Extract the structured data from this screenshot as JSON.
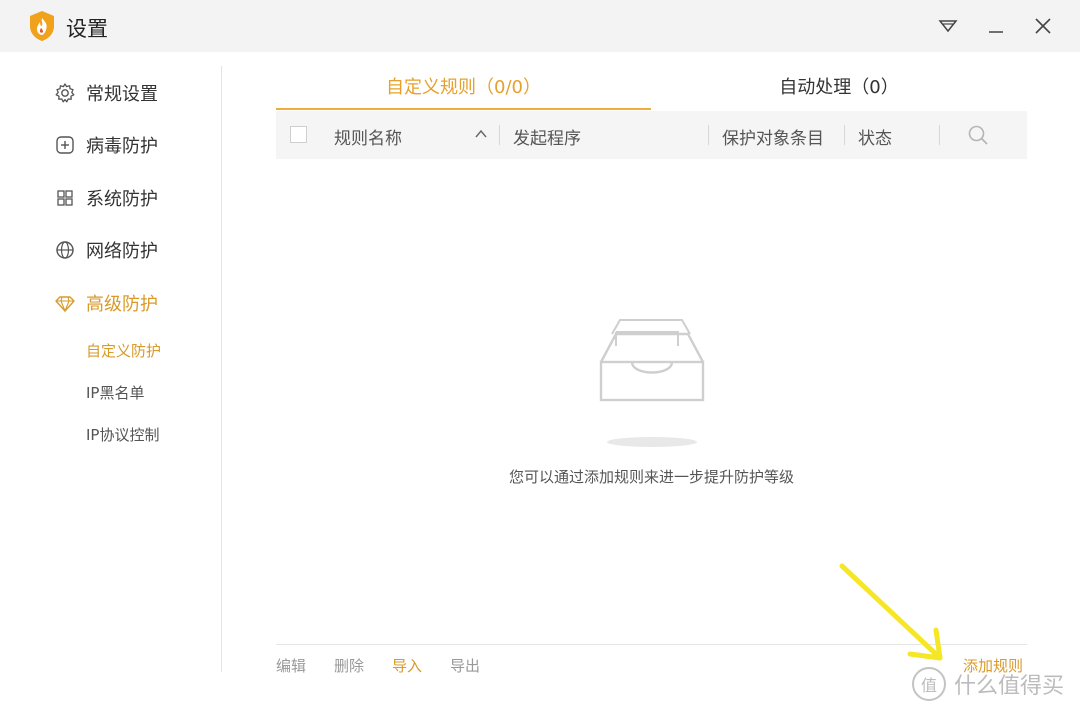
{
  "window": {
    "title": "设置",
    "icons": {
      "logo": "shield-flame-logo",
      "menu": "dropdown-menu-icon",
      "minimize": "minimize-icon",
      "close": "close-icon"
    }
  },
  "colors": {
    "accent": "#e6a12c",
    "nav_active": "#d99a29",
    "titlebar_bg": "#f3f3f3",
    "header_bg": "#f5f5f5",
    "arrow": "#f5e626"
  },
  "sidebar": {
    "items": [
      {
        "label": "常规设置",
        "icon": "gear-icon"
      },
      {
        "label": "病毒防护",
        "icon": "plus-square-icon"
      },
      {
        "label": "系统防护",
        "icon": "windows-grid-icon"
      },
      {
        "label": "网络防护",
        "icon": "globe-icon"
      },
      {
        "label": "高级防护",
        "icon": "diamond-icon",
        "active": true
      }
    ],
    "sub_items": [
      {
        "label": "自定义防护",
        "active": true
      },
      {
        "label": "IP黑名单"
      },
      {
        "label": "IP协议控制"
      }
    ]
  },
  "tabs": [
    {
      "label": "自定义规则（0/0）",
      "active": true
    },
    {
      "label": "自动处理（0）"
    }
  ],
  "table": {
    "columns": [
      "规则名称",
      "发起程序",
      "保护对象条目",
      "状态"
    ],
    "sort_icon": "chevron-up-icon",
    "search_icon": "search-icon"
  },
  "empty_state": {
    "icon": "empty-inbox-icon",
    "message": "您可以通过添加规则来进一步提升防护等级"
  },
  "footer": {
    "actions": [
      "编辑",
      "删除",
      "导入",
      "导出"
    ],
    "add_rule": "添加规则"
  },
  "watermark": {
    "text": "什么值得买",
    "logo_glyph": "值"
  }
}
